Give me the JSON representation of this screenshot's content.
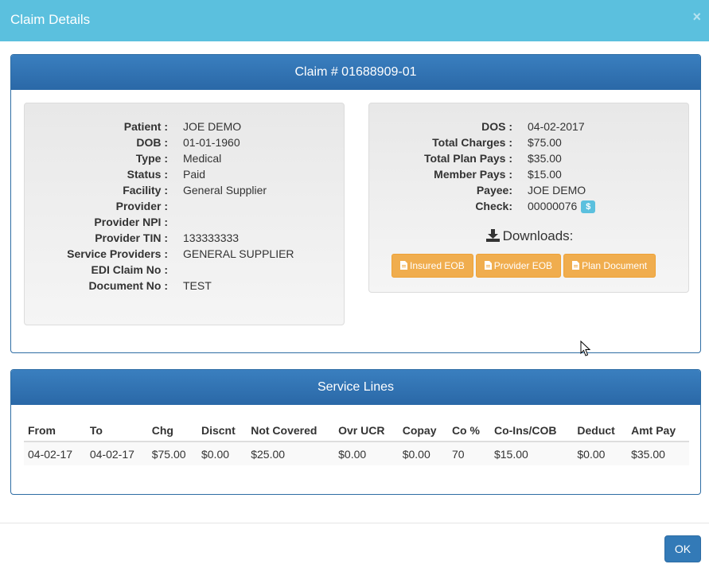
{
  "modal": {
    "title": "Claim Details",
    "close_glyph": "×",
    "ok_label": "OK"
  },
  "claim": {
    "heading": "Claim # 01688909-01",
    "left": [
      {
        "label": "Patient :",
        "value": "JOE DEMO"
      },
      {
        "label": "DOB :",
        "value": "01-01-1960"
      },
      {
        "label": "Type :",
        "value": "Medical"
      },
      {
        "label": "Status :",
        "value": "Paid"
      },
      {
        "label": "Facility :",
        "value": "General Supplier"
      },
      {
        "label": "Provider :",
        "value": ""
      },
      {
        "label": "Provider NPI :",
        "value": ""
      },
      {
        "label": "Provider TIN :",
        "value": "133333333"
      },
      {
        "label": "Service Providers :",
        "value": "GENERAL SUPPLIER"
      },
      {
        "label": "EDI Claim No :",
        "value": ""
      },
      {
        "label": "Document No :",
        "value": "TEST"
      }
    ],
    "right": [
      {
        "label": "DOS :",
        "value": "04-02-2017"
      },
      {
        "label": "Total Charges :",
        "value": "$75.00"
      },
      {
        "label": "Total Plan Pays :",
        "value": "$35.00"
      },
      {
        "label": "Member Pays :",
        "value": "$15.00"
      },
      {
        "label": "Payee:",
        "value": "JOE DEMO"
      },
      {
        "label": "Check:",
        "value": "00000076"
      }
    ],
    "check_badge": "$",
    "downloads_title": "Downloads:",
    "buttons": [
      {
        "label": "Insured EOB",
        "icon": "file-icon"
      },
      {
        "label": "Provider EOB",
        "icon": "file-icon"
      },
      {
        "label": "Plan Document",
        "icon": "file-icon"
      }
    ]
  },
  "service_lines": {
    "heading": "Service Lines",
    "columns": [
      "From",
      "To",
      "Chg",
      "Discnt",
      "Not Covered",
      "Ovr UCR",
      "Copay",
      "Co %",
      "Co-Ins/COB",
      "Deduct",
      "Amt Pay"
    ],
    "rows": [
      [
        "04-02-17",
        "04-02-17",
        "$75.00",
        "$0.00",
        "$25.00",
        "$0.00",
        "$0.00",
        "70",
        "$15.00",
        "$0.00",
        "$35.00"
      ]
    ]
  },
  "colors": {
    "header": "#5bc0de",
    "panel_heading": "#2e6da4",
    "warning_button": "#f0ad4e",
    "primary_button": "#337ab7"
  }
}
